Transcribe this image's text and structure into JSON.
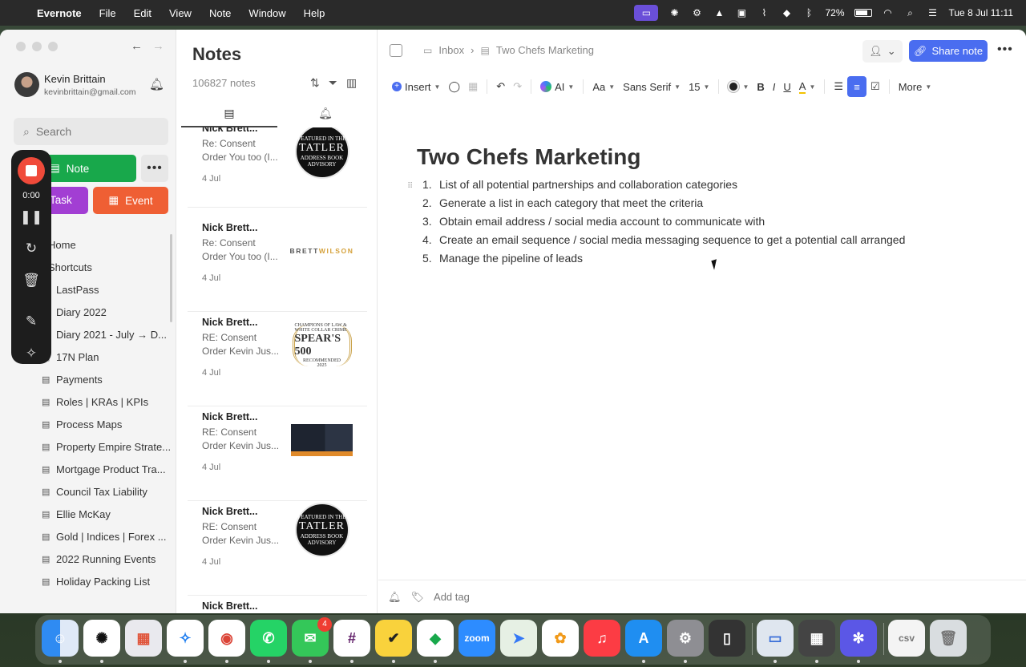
{
  "menubar": {
    "app_name": "Evernote",
    "menus": [
      "File",
      "Edit",
      "View",
      "Note",
      "Window",
      "Help"
    ],
    "battery": "72%",
    "clock": "Tue 8 Jul  11:11"
  },
  "sidebar": {
    "user_name": "Kevin Brittain",
    "user_email": "kevinbrittain@gmail.com",
    "search_placeholder": "Search",
    "note_button": "Note",
    "task_button": "Task",
    "event_button": "Event",
    "items": [
      {
        "label": "Home",
        "icon": "home-icon",
        "top": true
      },
      {
        "label": "Shortcuts",
        "icon": "star-icon",
        "top": true
      },
      {
        "label": "LastPass",
        "icon": "note-icon"
      },
      {
        "label": "Diary 2022",
        "icon": "note-icon"
      },
      {
        "label": "Diary 2021 - July → D...",
        "icon": "note-icon"
      },
      {
        "label": "17N Plan",
        "icon": "note-icon"
      },
      {
        "label": "Payments",
        "icon": "note-icon"
      },
      {
        "label": "Roles | KRAs | KPIs",
        "icon": "note-icon"
      },
      {
        "label": "Process Maps",
        "icon": "note-icon"
      },
      {
        "label": "Property Empire Strate...",
        "icon": "note-icon"
      },
      {
        "label": "Mortgage Product Tra...",
        "icon": "note-icon"
      },
      {
        "label": "Council Tax Liability",
        "icon": "note-icon"
      },
      {
        "label": "Ellie McKay",
        "icon": "note-icon"
      },
      {
        "label": "Gold | Indices | Forex ...",
        "icon": "note-icon"
      },
      {
        "label": "2022 Running Events",
        "icon": "note-icon"
      },
      {
        "label": "Holiday Packing List",
        "icon": "note-icon"
      }
    ]
  },
  "recorder": {
    "time": "0:00"
  },
  "notes_list": {
    "title": "Notes",
    "count": "106827 notes",
    "cards": [
      {
        "title": "Nick Brett...",
        "snippet": "Re: Consent Order You too (I...",
        "date": "4 Jul",
        "thumb": "tatler"
      },
      {
        "title": "Nick Brett...",
        "snippet": "Re: Consent Order You too (I...",
        "date": "4 Jul",
        "thumb": "brettwilson"
      },
      {
        "title": "Nick Brett...",
        "snippet": "RE: Consent Order Kevin Jus...",
        "date": "4 Jul",
        "thumb": "spears"
      },
      {
        "title": "Nick Brett...",
        "snippet": "RE: Consent Order Kevin Jus...",
        "date": "4 Jul",
        "thumb": "slide"
      },
      {
        "title": "Nick Brett...",
        "snippet": "RE: Consent Order Kevin Jus...",
        "date": "4 Jul",
        "thumb": "tatler"
      },
      {
        "title": "Nick Brett...",
        "snippet": "",
        "date": "",
        "thumb": "none"
      }
    ],
    "thumb_text": {
      "tatler_top": "FEATURED IN THE",
      "tatler_main": "TATLER",
      "tatler_sub": "ADDRESS BOOK",
      "tatler_bottom": "ADVISORY",
      "brett": "BRETT",
      "wilson": "WILSON",
      "spears_top": "CHAMPIONS OF LAW & WHITE COLLAR CRIME",
      "spears_main": "SPEAR'S 500",
      "spears_sub": "RECOMMENDED",
      "spears_year": "2025"
    }
  },
  "editor": {
    "breadcrumb": [
      "Inbox",
      "Two Chefs Marketing"
    ],
    "share_label": "Share note",
    "toolbar": {
      "insert": "Insert",
      "ai": "AI",
      "font_size_label": "Aa",
      "font_family": "Sans Serif",
      "font_size": "15",
      "more": "More"
    },
    "title": "Two Chefs Marketing",
    "list": [
      "List of all potential partnerships and collaboration categories",
      "Generate a list in each category that meet the criteria",
      "Obtain email address / social media account to communicate with",
      "Create an email sequence / social media messaging sequence to get a potential call arranged",
      "Manage the pipeline of leads"
    ],
    "add_tag": "Add tag"
  },
  "dock": {
    "messages_badge": "4",
    "zoom_label": "zoom",
    "apps": [
      "Finder",
      "ChatGPT",
      "Launchpad",
      "Safari",
      "Chrome",
      "WhatsApp",
      "Messages",
      "Slack",
      "Notes",
      "Evernote",
      "Zoom",
      "Maps",
      "Photos",
      "Music",
      "App Store",
      "System Settings",
      "iPhone Mirroring",
      "Preview",
      "Calculator",
      "Perplexity",
      "CSV",
      "Trash"
    ]
  },
  "colors": {
    "evernote_green": "#18a84b",
    "task_purple": "#a23ed3",
    "event_orange": "#ef5f34",
    "share_blue": "#4a6df0",
    "record_red": "#f04a3a"
  }
}
